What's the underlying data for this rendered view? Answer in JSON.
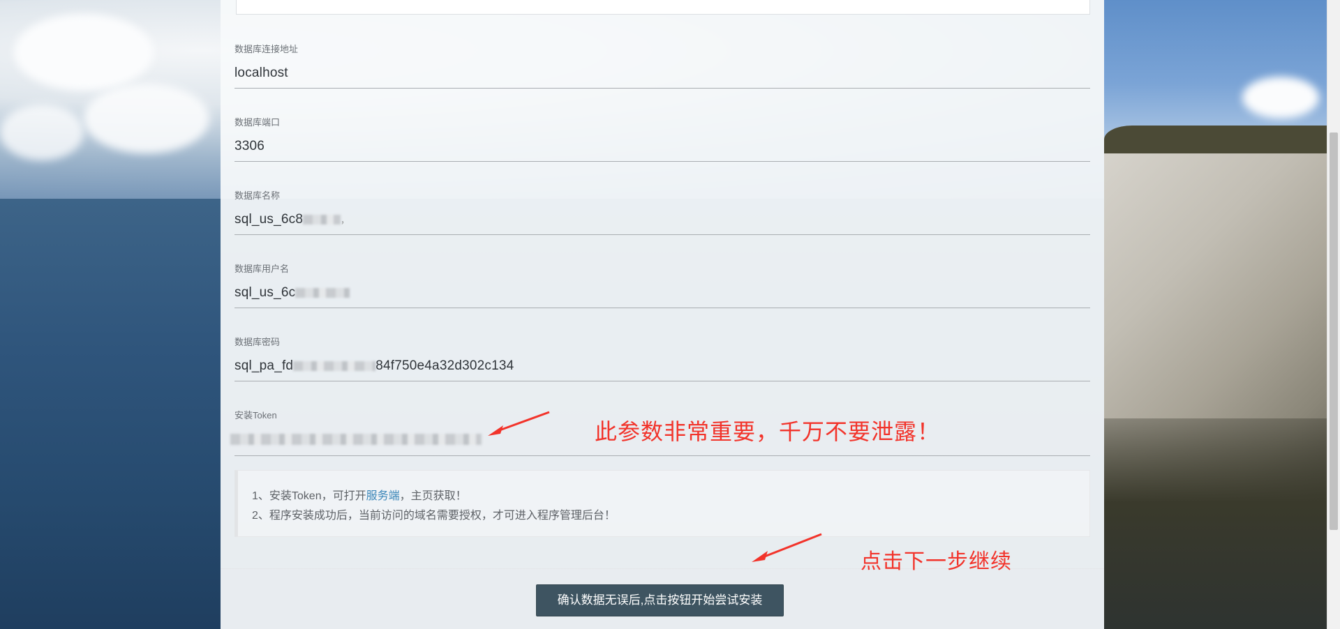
{
  "form": {
    "fields": [
      {
        "label": "数据库连接地址",
        "value": "localhost"
      },
      {
        "label": "数据库端口",
        "value": "3306"
      },
      {
        "label": "数据库名称",
        "value_prefix": "sql_us_6c8",
        "value_suffix": "，",
        "masked": true
      },
      {
        "label": "数据库用户名",
        "value_prefix": "sql_us_6c",
        "masked": true
      },
      {
        "label": "数据库密码",
        "value_prefix": "sql_pa_fd",
        "value_suffix": "84f750e4a32d302c134",
        "masked": true
      },
      {
        "label": "安装Token",
        "masked": true
      }
    ]
  },
  "notice": {
    "line1_prefix": "1、安装Token，可打开",
    "line1_link": "服务端",
    "line1_suffix": "，主页获取！",
    "line2": "2、程序安装成功后，当前访问的域名需要授权，才可进入程序管理后台！"
  },
  "submit": {
    "label": "确认数据无误后,点击按钮开始尝试安装"
  },
  "annotations": {
    "token_warning": "此参数非常重要，千万不要泄露！",
    "next_step": "点击下一步继续",
    "color": "#f2332a"
  },
  "colors": {
    "button_bg": "#3e5461",
    "link": "#3a86b8"
  }
}
